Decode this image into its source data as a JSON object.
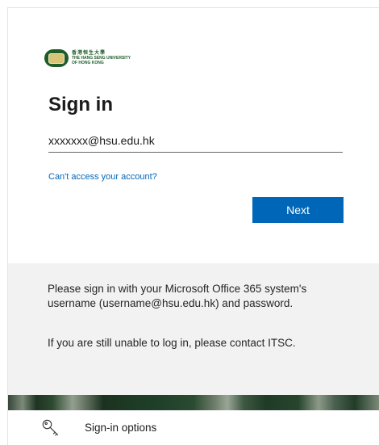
{
  "logo": {
    "chinese_name": "香港恒生大學",
    "english_line1": "THE HANG SENG UNIVERSITY",
    "english_line2": "OF HONG KONG"
  },
  "signin": {
    "title": "Sign in",
    "email_value": "xxxxxxx@hsu.edu.hk",
    "cant_access_link": "Can't access your account?",
    "next_label": "Next"
  },
  "info": {
    "message_1": "Please sign in with your Microsoft Office 365 system's username (username@hsu.edu.hk) and password.",
    "message_2": "If you are still unable to log in, please contact ITSC."
  },
  "signin_options": {
    "label": "Sign-in options",
    "icon": "key-icon"
  },
  "colors": {
    "accent": "#0067b8",
    "panel_background": "#f2f2f2",
    "brand_green": "#1e5c2a"
  }
}
